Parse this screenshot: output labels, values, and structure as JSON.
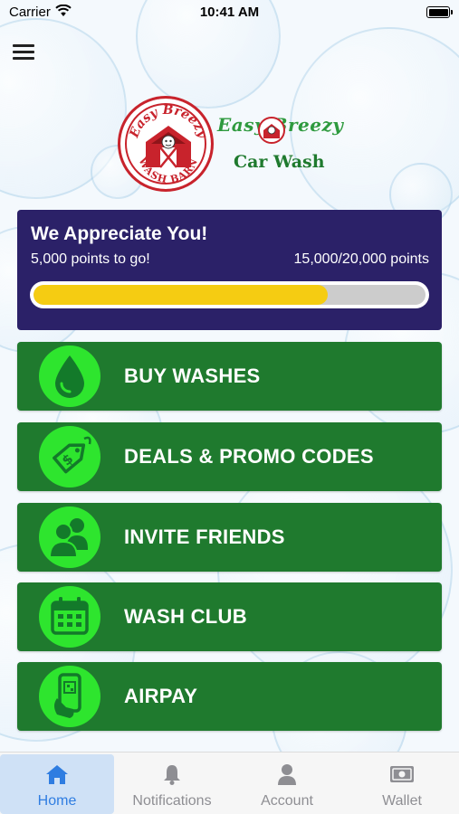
{
  "status_bar": {
    "carrier": "Carrier",
    "time": "10:41 AM"
  },
  "brand": {
    "seal_text_top": "Easy Breezy",
    "seal_text_bottom": "WASH BARN",
    "name_line1": "Easy Breezy",
    "name_line2": "Car Wash",
    "colors": {
      "red": "#c8232c",
      "green": "#2e9a3e"
    }
  },
  "rewards": {
    "title": "We Appreciate You!",
    "points_to_go": "5,000 points to go!",
    "points_total": "15,000/20,000 points",
    "progress_fraction": 0.75,
    "colors": {
      "card_bg": "#2b2168",
      "bar_fill": "#f5cc12"
    }
  },
  "actions": [
    {
      "label": "BUY WASHES",
      "icon": "water-drop-icon"
    },
    {
      "label": "DEALS & PROMO CODES",
      "icon": "price-tag-icon"
    },
    {
      "label": "INVITE FRIENDS",
      "icon": "people-icon"
    },
    {
      "label": "WASH CLUB",
      "icon": "calendar-icon"
    },
    {
      "label": "AIRPAY",
      "icon": "phone-pay-icon"
    }
  ],
  "action_colors": {
    "button_bg": "#1f7a2e",
    "icon_bg": "#2ee52e"
  },
  "tabs": [
    {
      "label": "Home",
      "icon": "home-icon",
      "active": true
    },
    {
      "label": "Notifications",
      "icon": "bell-icon",
      "active": false
    },
    {
      "label": "Account",
      "icon": "person-icon",
      "active": false
    },
    {
      "label": "Wallet",
      "icon": "wallet-icon",
      "active": false
    }
  ]
}
